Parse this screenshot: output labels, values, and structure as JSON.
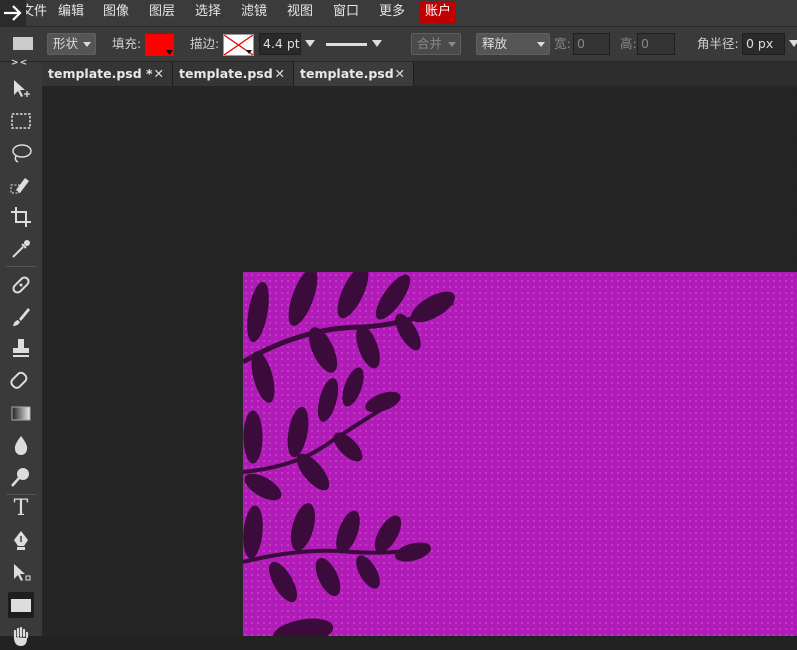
{
  "menubar": {
    "items": [
      "文件",
      "编辑",
      "图像",
      "图层",
      "选择",
      "滤镜",
      "视图",
      "窗口",
      "更多"
    ],
    "account": "账户"
  },
  "options": {
    "shape_mode": "形状",
    "fill_label": "填充:",
    "fill_color": "#ff0000",
    "stroke_label": "描边:",
    "stroke_width": "4.4 pt",
    "combine_label": "合并",
    "release_label": "释放",
    "width_label": "宽:",
    "width_value": "0",
    "height_label": "高:",
    "height_value": "0",
    "radius_label": "角半径:",
    "radius_value": "0 px"
  },
  "tabs": [
    {
      "label": "template.psd *",
      "close": "✕"
    },
    {
      "label": "template.psd",
      "close": "✕"
    },
    {
      "label": "template.psd",
      "close": "✕"
    }
  ],
  "panel_toggle": "> <",
  "canvas": {
    "background": "#b11bb8",
    "leaf_color": "#3a0b3b"
  },
  "tools": [
    "move-tool",
    "marquee-tool",
    "lasso-tool",
    "quick-select-tool",
    "crop-tool",
    "eyedropper-tool",
    "healing-tool",
    "brush-tool",
    "stamp-tool",
    "eraser-tool",
    "gradient-tool",
    "blur-tool",
    "dodge-tool",
    "type-tool",
    "pen-tool",
    "path-select-tool",
    "shape-tool",
    "hand-tool"
  ],
  "type_tool_glyph": "T"
}
